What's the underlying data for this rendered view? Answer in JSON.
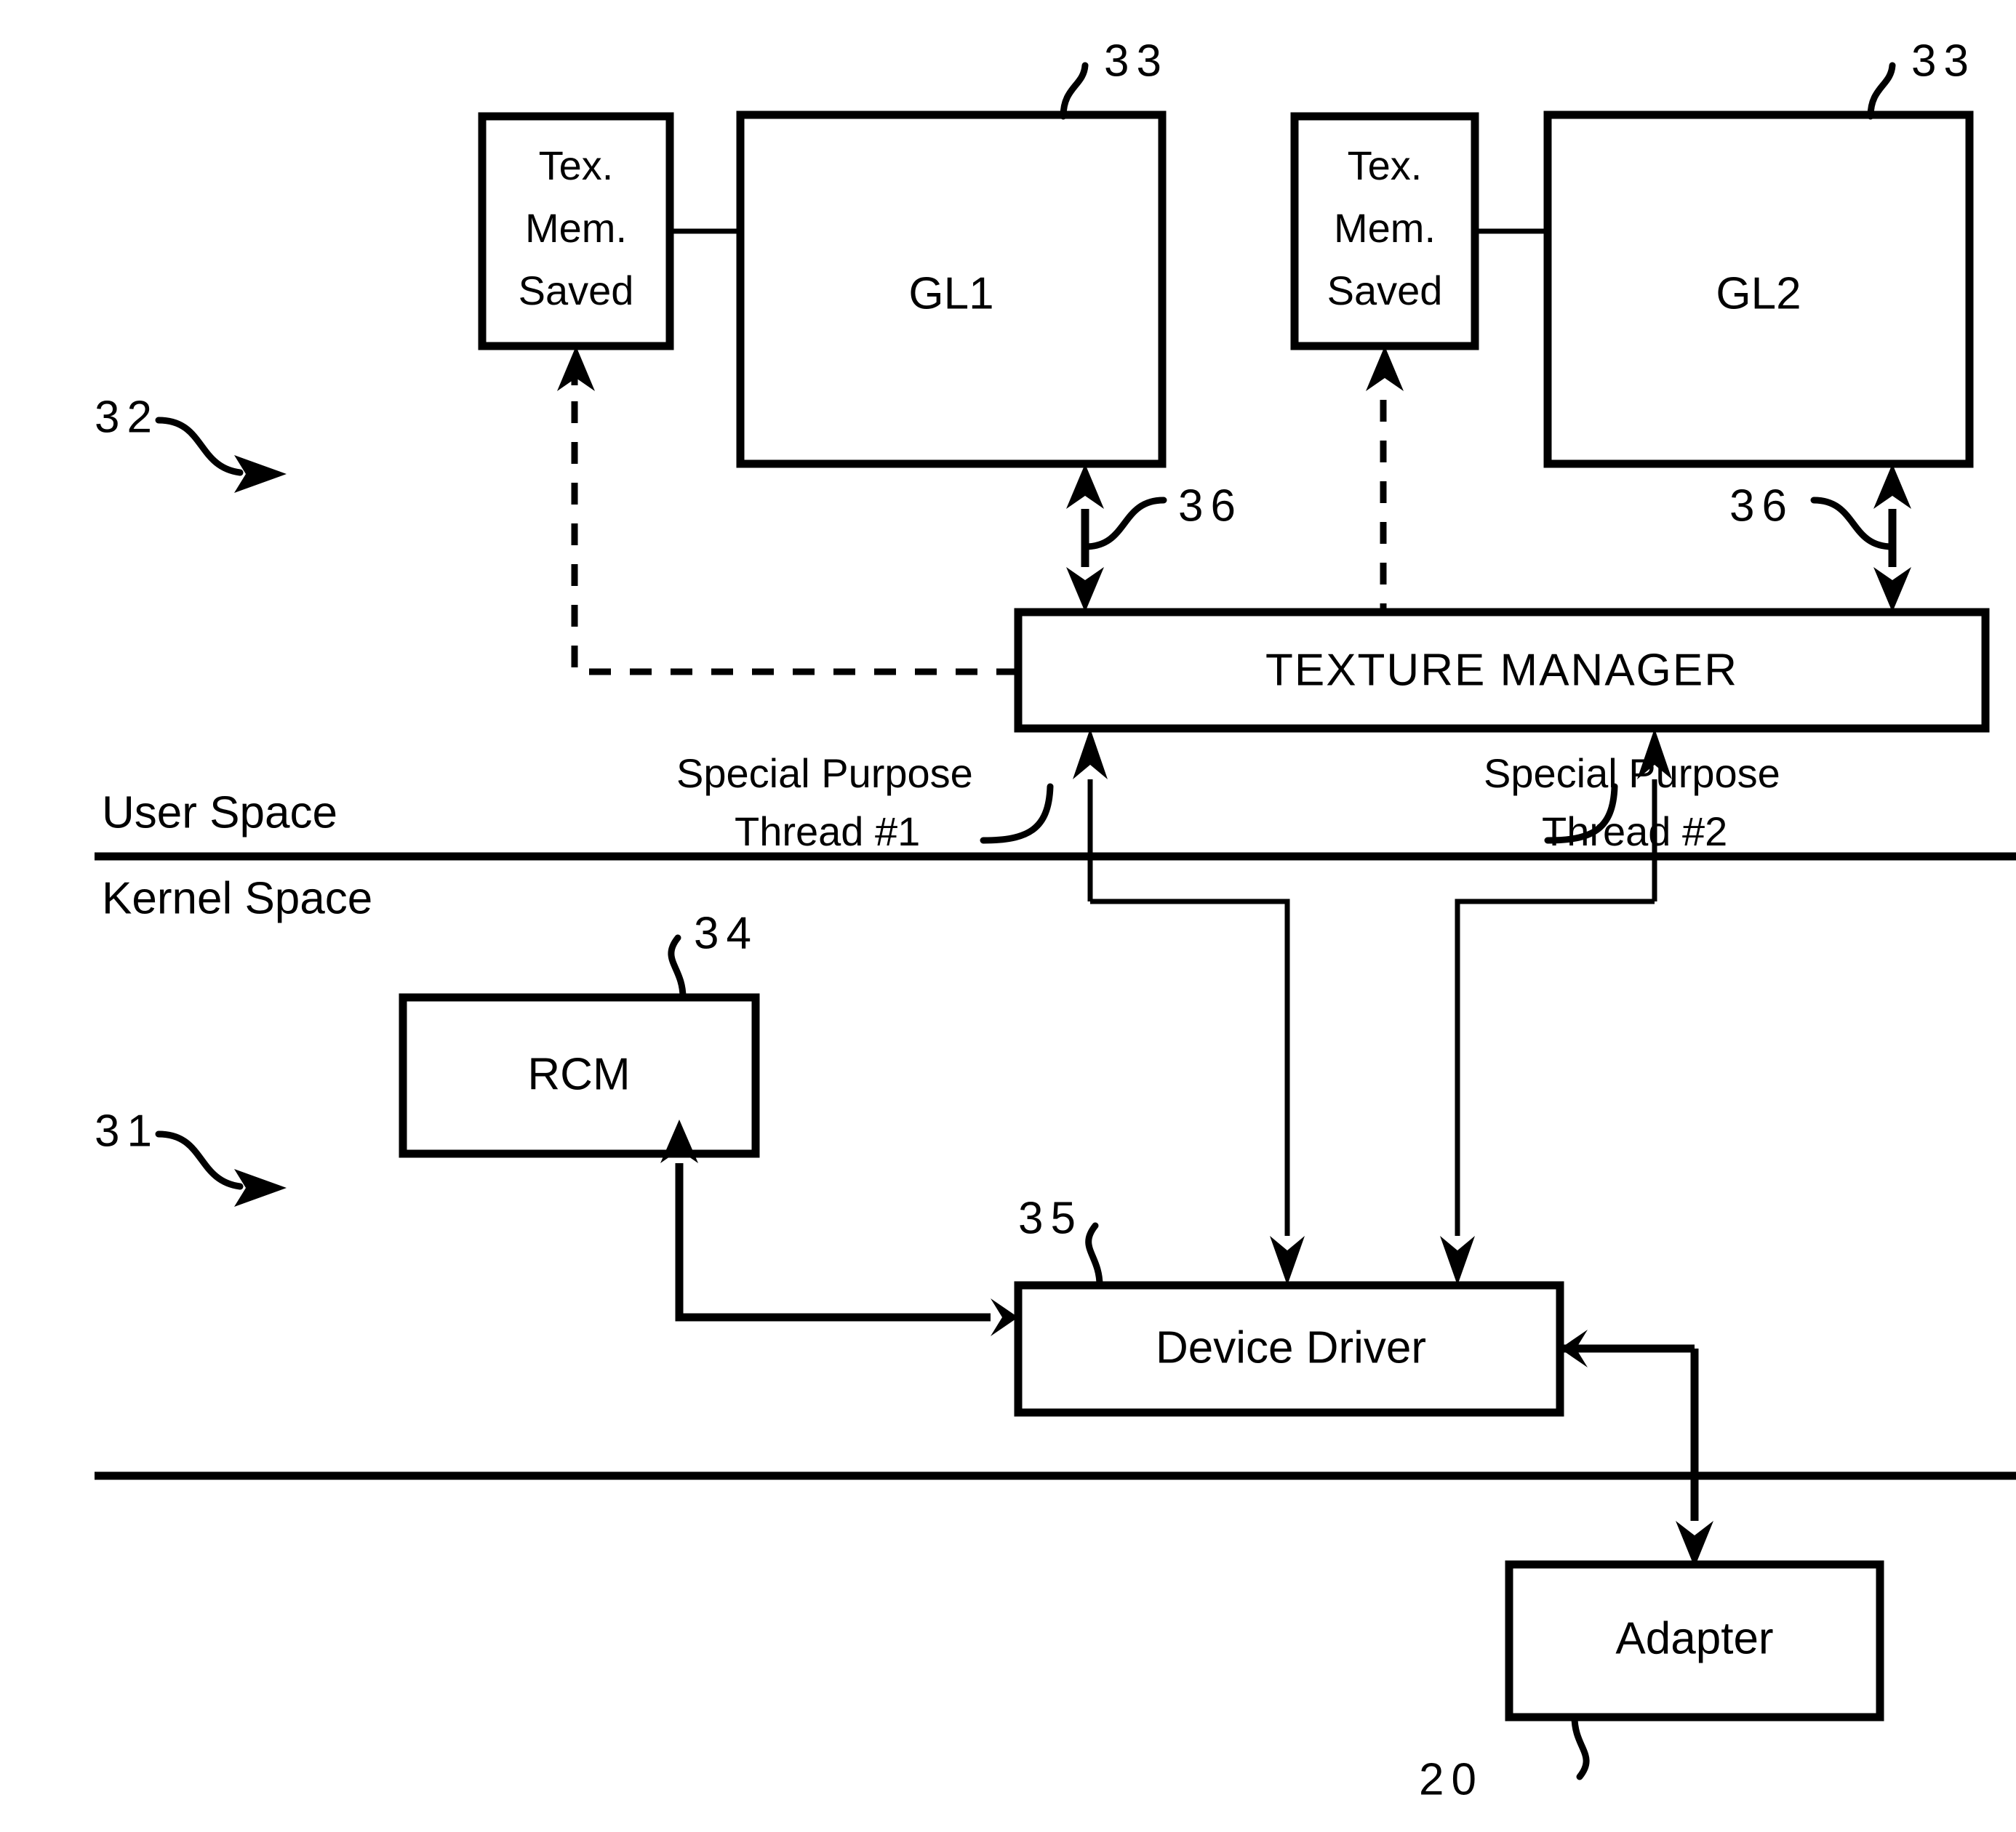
{
  "figure": {
    "type": "patent-block-diagram",
    "background_color": "#ffffff",
    "line_color": "#000000"
  },
  "boxes": {
    "tex_mem_1": {
      "line1": "Tex.",
      "line2": "Mem.",
      "line3": "Saved"
    },
    "tex_mem_2": {
      "line1": "Tex.",
      "line2": "Mem.",
      "line3": "Saved"
    },
    "gl1": {
      "label": "GL1"
    },
    "gl2": {
      "label": "GL2"
    },
    "texture_manager": {
      "label": "TEXTURE MANAGER"
    },
    "rcm": {
      "label": "RCM"
    },
    "device_driver": {
      "label": "Device Driver"
    },
    "adapter": {
      "label": "Adapter"
    }
  },
  "reference_numerals": {
    "gl1_ref": "33",
    "gl2_ref": "33",
    "user_space_ref": "32",
    "kernel_space_ref": "31",
    "tm_gl1_link_ref": "36",
    "tm_gl2_link_ref": "36",
    "rcm_ref": "34",
    "device_driver_ref": "35",
    "adapter_ref": "20"
  },
  "space_labels": {
    "user_space": "User Space",
    "kernel_space": "Kernel Space"
  },
  "thread_labels": {
    "thread1_line1": "Special Purpose",
    "thread1_line2": "Thread #1",
    "thread2_line1": "Special Purpose",
    "thread2_line2": "Thread #2"
  }
}
